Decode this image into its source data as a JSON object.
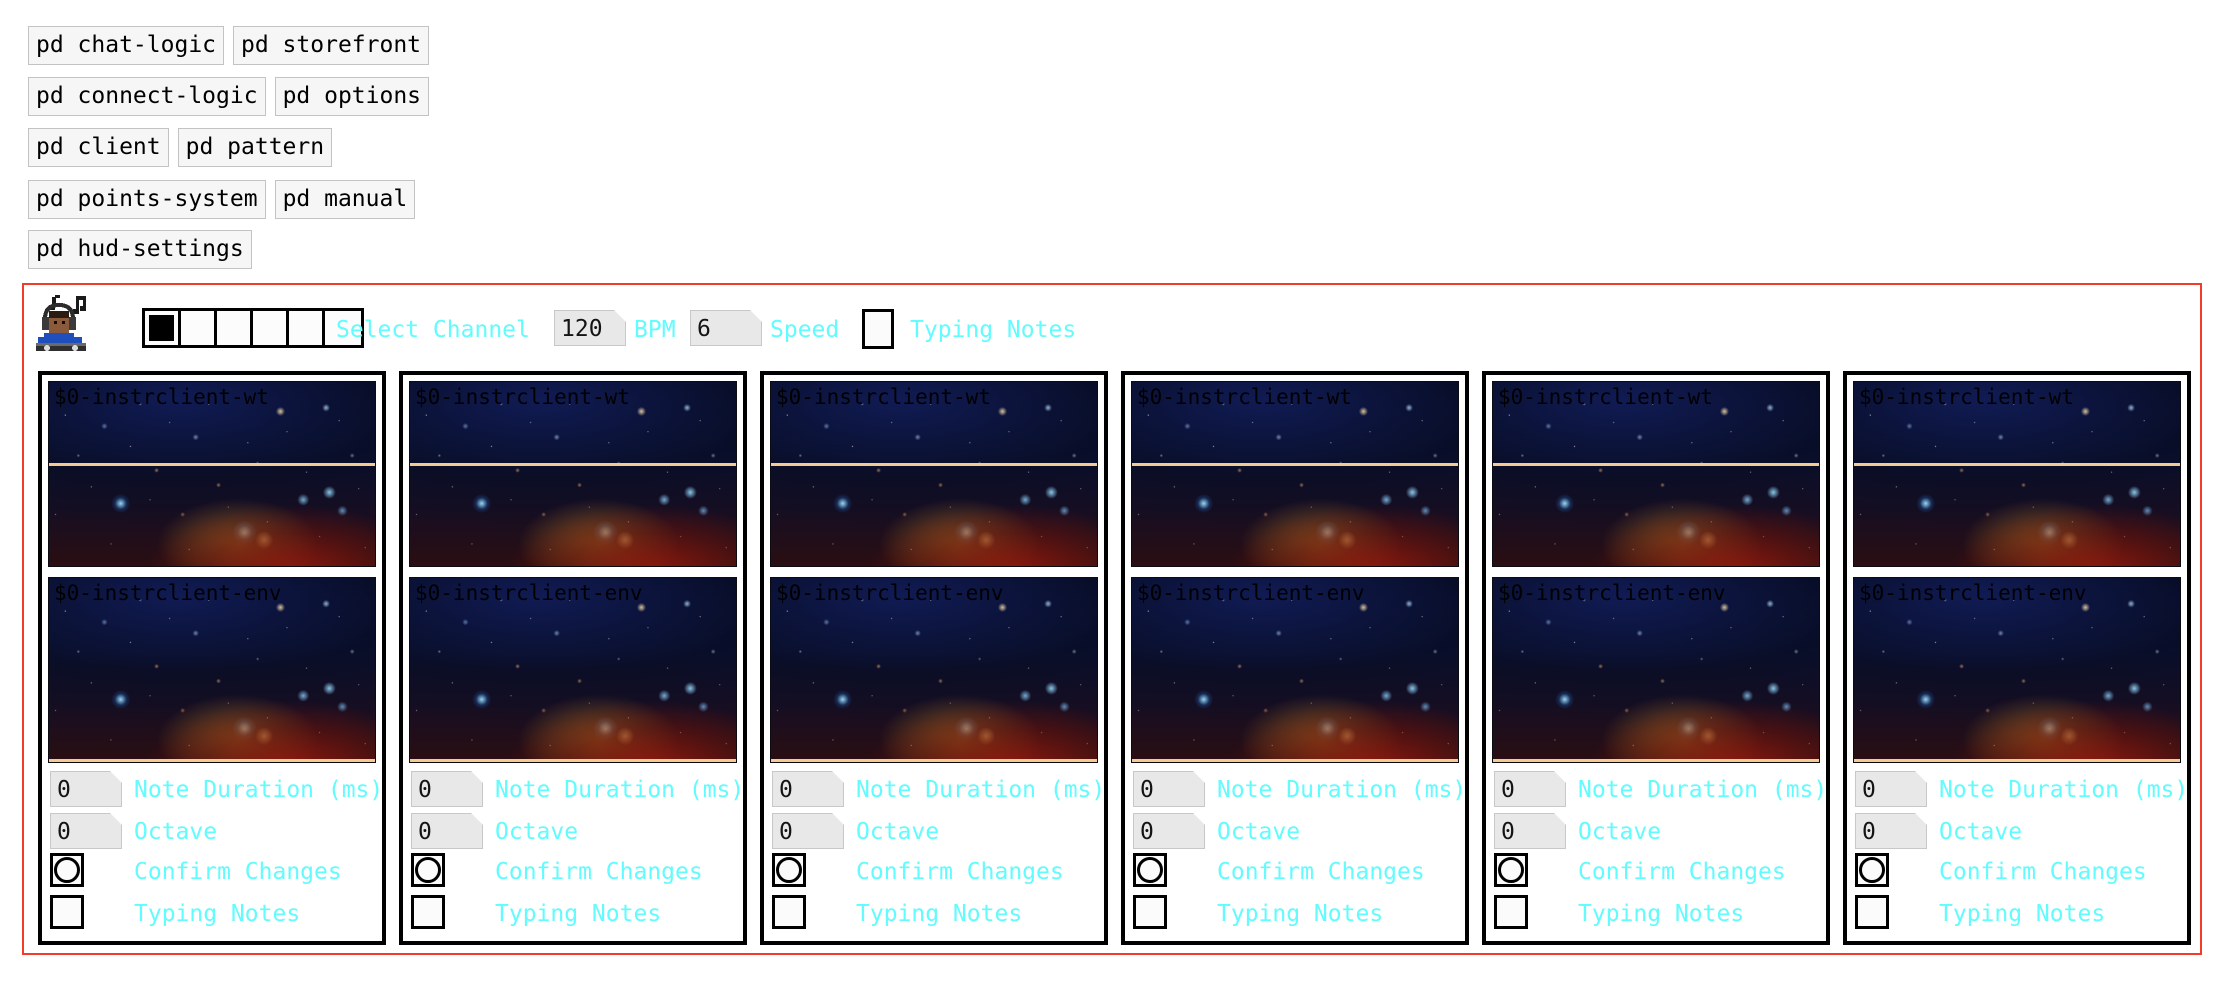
{
  "window": {
    "background": "#ffffff",
    "canvas_border_color": "#f23b29",
    "label_color": "#62fbfe",
    "trace_color": "#f4cb93"
  },
  "objects": [
    [
      {
        "label": "pd chat-logic"
      },
      {
        "label": "pd storefront"
      }
    ],
    [
      {
        "label": "pd connect-logic"
      },
      {
        "label": "pd options"
      }
    ],
    [
      {
        "label": "pd client"
      },
      {
        "label": "pd pattern"
      }
    ],
    [
      {
        "label": "pd points-system"
      },
      {
        "label": "pd manual"
      }
    ],
    [
      {
        "label": "pd hud-settings"
      }
    ]
  ],
  "toolbar": {
    "icon": "dj-headphones-icon",
    "channel_radio": {
      "cells": 6,
      "selected": 0
    },
    "select_channel_label": "Select Channel",
    "bpm": {
      "value": "120",
      "label": "BPM"
    },
    "speed": {
      "value": "6",
      "label": "Speed"
    },
    "typing_notes": {
      "label": "Typing Notes",
      "checked": false
    }
  },
  "panels": [
    {
      "arrays": [
        {
          "name": "$0-instrclient-wt",
          "kind": "wavetable"
        },
        {
          "name": "$0-instrclient-env",
          "kind": "envelope"
        }
      ],
      "controls": {
        "note_duration": {
          "value": "0",
          "label": "Note Duration (ms)"
        },
        "octave": {
          "value": "0",
          "label": "Octave"
        },
        "confirm": {
          "label": "Confirm Changes"
        },
        "typing": {
          "label": "Typing Notes",
          "checked": false
        }
      }
    },
    {
      "arrays": [
        {
          "name": "$0-instrclient-wt",
          "kind": "wavetable"
        },
        {
          "name": "$0-instrclient-env",
          "kind": "envelope"
        }
      ],
      "controls": {
        "note_duration": {
          "value": "0",
          "label": "Note Duration (ms)"
        },
        "octave": {
          "value": "0",
          "label": "Octave"
        },
        "confirm": {
          "label": "Confirm Changes"
        },
        "typing": {
          "label": "Typing Notes",
          "checked": false
        }
      }
    },
    {
      "arrays": [
        {
          "name": "$0-instrclient-wt",
          "kind": "wavetable"
        },
        {
          "name": "$0-instrclient-env",
          "kind": "envelope"
        }
      ],
      "controls": {
        "note_duration": {
          "value": "0",
          "label": "Note Duration (ms)"
        },
        "octave": {
          "value": "0",
          "label": "Octave"
        },
        "confirm": {
          "label": "Confirm Changes"
        },
        "typing": {
          "label": "Typing Notes",
          "checked": false
        }
      }
    },
    {
      "arrays": [
        {
          "name": "$0-instrclient-wt",
          "kind": "wavetable"
        },
        {
          "name": "$0-instrclient-env",
          "kind": "envelope"
        }
      ],
      "controls": {
        "note_duration": {
          "value": "0",
          "label": "Note Duration (ms)"
        },
        "octave": {
          "value": "0",
          "label": "Octave"
        },
        "confirm": {
          "label": "Confirm Changes"
        },
        "typing": {
          "label": "Typing Notes",
          "checked": false
        }
      }
    },
    {
      "arrays": [
        {
          "name": "$0-instrclient-wt",
          "kind": "wavetable"
        },
        {
          "name": "$0-instrclient-env",
          "kind": "envelope"
        }
      ],
      "controls": {
        "note_duration": {
          "value": "0",
          "label": "Note Duration (ms)"
        },
        "octave": {
          "value": "0",
          "label": "Octave"
        },
        "confirm": {
          "label": "Confirm Changes"
        },
        "typing": {
          "label": "Typing Notes",
          "checked": false
        }
      }
    },
    {
      "arrays": [
        {
          "name": "$0-instrclient-wt",
          "kind": "wavetable"
        },
        {
          "name": "$0-instrclient-env",
          "kind": "envelope"
        }
      ],
      "controls": {
        "note_duration": {
          "value": "0",
          "label": "Note Duration (ms)"
        },
        "octave": {
          "value": "0",
          "label": "Octave"
        },
        "confirm": {
          "label": "Confirm Changes"
        },
        "typing": {
          "label": "Typing Notes",
          "checked": false
        }
      }
    }
  ]
}
